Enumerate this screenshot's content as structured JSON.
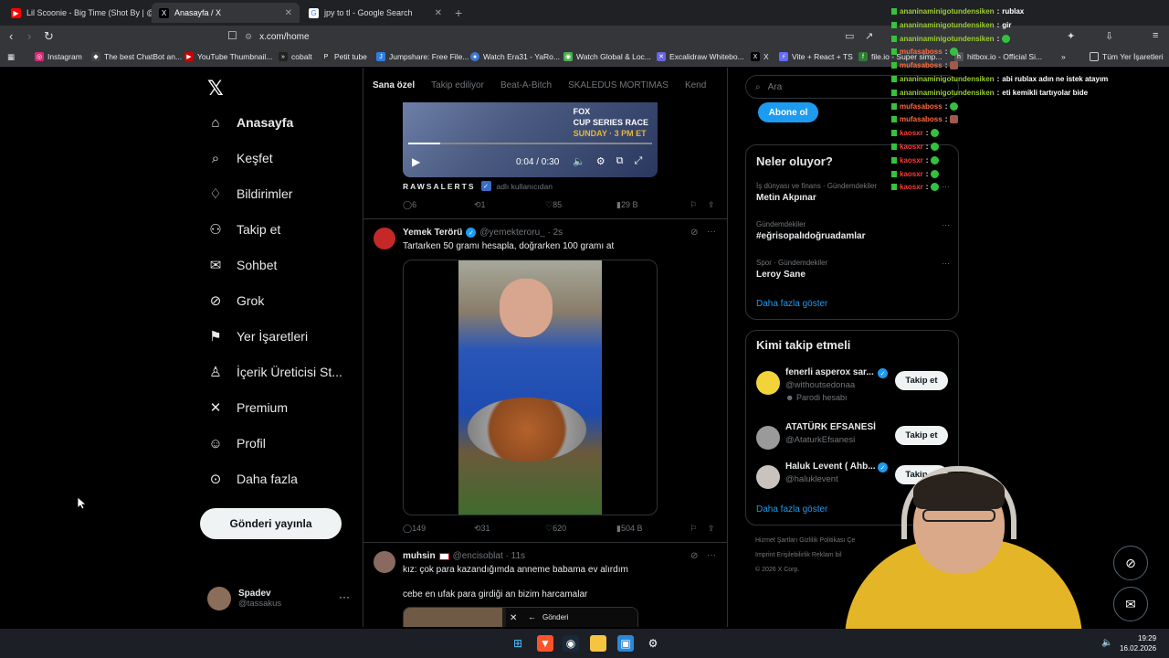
{
  "tabs": [
    {
      "title": "Lil Scoonie - Big Time (Shot By | @ey",
      "icon_color": "#ff0000",
      "active": false
    },
    {
      "title": "Anasayfa / X",
      "icon_color": "#000000",
      "active": true
    },
    {
      "title": "jpy to tl - Google Search",
      "icon_color": "#4285f4",
      "active": false
    }
  ],
  "address": {
    "url": "x.com/home"
  },
  "bookmarks": [
    {
      "label": "Instagram",
      "color": "#d62976"
    },
    {
      "label": "The best ChatBot an...",
      "color": "#444"
    },
    {
      "label": "YouTube Thumbnail...",
      "color": "#cc0000"
    },
    {
      "label": "cobalt",
      "color": "#222"
    },
    {
      "label": "Petit tube",
      "color": "#333"
    },
    {
      "label": "Jumpshare: Free File...",
      "color": "#2f7de1"
    },
    {
      "label": "Watch Era31 - YaRo...",
      "color": "#3a7bd5"
    },
    {
      "label": "Watch Global & Loc...",
      "color": "#4caf50"
    },
    {
      "label": "Excalidraw Whitebo...",
      "color": "#6965db"
    },
    {
      "label": "X",
      "color": "#000"
    },
    {
      "label": "Vite + React + TS",
      "color": "#646cff"
    },
    {
      "label": "file.io - Super simp...",
      "color": "#2e7d32"
    },
    {
      "label": "hitbox.io - Official Si...",
      "color": "#555"
    }
  ],
  "all_bookmarks": "Tüm Yer İşaretleri",
  "nav": {
    "items": [
      {
        "label": "Anasayfa",
        "icon": "home-icon"
      },
      {
        "label": "Keşfet",
        "icon": "search-icon"
      },
      {
        "label": "Bildirimler",
        "icon": "bell-icon"
      },
      {
        "label": "Takip et",
        "icon": "add-user-icon"
      },
      {
        "label": "Sohbet",
        "icon": "mail-icon"
      },
      {
        "label": "Grok",
        "icon": "grok-icon"
      },
      {
        "label": "Yer İşaretleri",
        "icon": "bookmark-icon"
      },
      {
        "label": "İçerik Üreticisi St...",
        "icon": "creator-icon"
      },
      {
        "label": "Premium",
        "icon": "x-logo-icon"
      },
      {
        "label": "Profil",
        "icon": "user-icon"
      },
      {
        "label": "Daha fazla",
        "icon": "more-icon"
      }
    ],
    "post_button": "Gönderi yayınla",
    "profile": {
      "name": "Spadev",
      "handle": "@tassakus"
    }
  },
  "feed": {
    "tabs": [
      "Sana özel",
      "Takip ediliyor",
      "Beat-A-Bitch",
      "SKALEDUS MORTIMAS",
      "Kend"
    ],
    "video1": {
      "overlay_line1": "FOX",
      "overlay_line2": "CUP SERIES RACE",
      "overlay_line3": "SUNDAY · 3 PM ET",
      "time": "0:04 / 0:30",
      "progress": 0.13
    },
    "caption_user": "RAWSALERTS",
    "caption_rest": "adlı kullanıcıdan",
    "post1_stats": {
      "replies": "6",
      "reposts": "1",
      "likes": "85",
      "views": "29 B"
    },
    "post2": {
      "name": "Yemek Terörü",
      "handle": "@yemekteroru_ · 2s",
      "text": "Tartarken 50 gramı hesapla, doğrarken 100 gramı at",
      "stats": {
        "replies": "149",
        "reposts": "31",
        "likes": "620",
        "views": "504 B"
      }
    },
    "post3": {
      "name": "muhsin",
      "handle": "@encisoblat · 11s",
      "text1": "kız: çok para kazandığımda anneme babama ev alırdım",
      "text2": "cebe en ufak para girdiği an bizim harcamalar",
      "media_label": "Gönderi"
    }
  },
  "right": {
    "search_placeholder": "Ara",
    "subscribe": "Abone ol",
    "trends_title": "Neler oluyor?",
    "trends": [
      {
        "category": "İş dünyası ve finans · Gündemdekiler",
        "title": "Metin Akpınar"
      },
      {
        "category": "Gündemdekiler",
        "title": "#eğrisopalıdoğruadamlar"
      },
      {
        "category": "Spor · Gündemdekiler",
        "title": "Leroy Sane"
      }
    ],
    "show_more": "Daha fazla göster",
    "who_title": "Kimi takip etmeli",
    "who": [
      {
        "name": "fenerli asperox sar...",
        "handle": "@withoutsedonaa",
        "extra": "Parodi hesabı",
        "verified": true
      },
      {
        "name": "ATATÜRK EFSANESİ",
        "handle": "@AtaturkEfsanesi",
        "extra": "",
        "verified": false
      },
      {
        "name": "Haluk Levent ( Ahb...",
        "handle": "@haluklevent",
        "extra": "",
        "verified": true
      }
    ],
    "follow_label": "Takip et",
    "footer1": "Hizmet Şartları   Gizlilik Politikası   Çe",
    "footer2": "Imprint   Erişilebilirlik   Reklam bil",
    "footer3": "© 2026 X Corp."
  },
  "chat": [
    {
      "user": "ananinaminigotundensiken",
      "msg": "rublax",
      "color": "#9acd32"
    },
    {
      "user": "ananinaminigotundensiken",
      "msg": "gir",
      "color": "#9acd32"
    },
    {
      "user": "ananinaminigotundensiken",
      "msg": "",
      "color": "#9acd32",
      "emote": "green"
    },
    {
      "user": "mufasaboss",
      "msg": "",
      "color": "#ff6a3d",
      "emote": "green"
    },
    {
      "user": "mufasaboss",
      "msg": "",
      "color": "#ff6a3d",
      "emote": "brown"
    },
    {
      "user": "ananinaminigotundensiken",
      "msg": "abi rublax adın ne istek atayım",
      "color": "#9acd32"
    },
    {
      "user": "ananinaminigotundensiken",
      "msg": "eti kemikli tartıyolar bide",
      "color": "#9acd32"
    },
    {
      "user": "mufasaboss",
      "msg": "",
      "color": "#ff6a3d",
      "emote": "green"
    },
    {
      "user": "mufasaboss",
      "msg": "",
      "color": "#ff6a3d",
      "emote": "brown"
    },
    {
      "user": "kaosxr",
      "msg": "",
      "color": "#ff3a3a",
      "emote": "green"
    },
    {
      "user": "kaosxr",
      "msg": "",
      "color": "#ff3a3a",
      "emote": "green"
    },
    {
      "user": "kaosxr",
      "msg": "",
      "color": "#ff3a3a",
      "emote": "green"
    },
    {
      "user": "kaosxr",
      "msg": "",
      "color": "#ff3a3a",
      "emote": "green"
    },
    {
      "user": "kaosxr",
      "msg": "",
      "color": "#ff3a3a",
      "emote": "green"
    }
  ],
  "taskbar": {
    "time": "19:29",
    "date": "16.02.2026"
  },
  "accent": "#1d9bf0"
}
